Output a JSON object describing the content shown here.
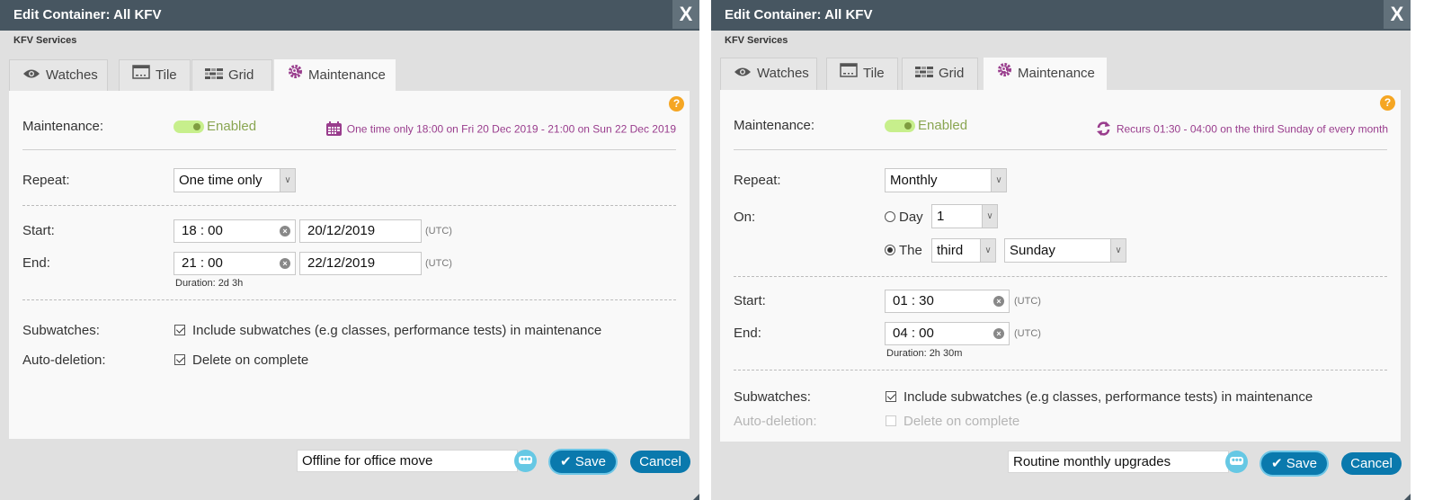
{
  "dialogs": [
    {
      "title": "Edit Container: All KFV",
      "close_label": "X",
      "subtitle": "KFV Services",
      "tabs": [
        {
          "label": "Watches",
          "icon": "eye-icon"
        },
        {
          "label": "Tile",
          "icon": "tile-icon"
        },
        {
          "label": "Grid",
          "icon": "grid-icon"
        },
        {
          "label": "Maintenance",
          "icon": "maintenance-gear-icon",
          "active": true
        }
      ],
      "help_label": "?",
      "maintenance": {
        "label": "Maintenance:",
        "toggle_state": "Enabled",
        "summary_icon": "calendar-icon",
        "summary": "One time only 18:00 on Fri 20 Dec 2019 - 21:00 on Sun 22 Dec 2019"
      },
      "repeat": {
        "label": "Repeat:",
        "value": "One time only"
      },
      "start": {
        "label": "Start:",
        "time": "18 : 00",
        "date": "20/12/2019",
        "tz": "(UTC)"
      },
      "end": {
        "label": "End:",
        "time": "21 : 00",
        "date": "22/12/2019",
        "tz": "(UTC)"
      },
      "duration": "Duration: 2d 3h",
      "subwatches": {
        "label": "Subwatches:",
        "text": "Include subwatches (e.g classes, performance tests) in maintenance",
        "checked": true
      },
      "autodeletion": {
        "label": "Auto-deletion:",
        "text": "Delete on complete",
        "checked": true,
        "disabled": false
      },
      "footer": {
        "note": "Offline for office move",
        "save_label": "Save",
        "cancel_label": "Cancel"
      }
    },
    {
      "title": "Edit Container: All KFV",
      "close_label": "X",
      "subtitle": "KFV Services",
      "tabs": [
        {
          "label": "Watches",
          "icon": "eye-icon"
        },
        {
          "label": "Tile",
          "icon": "tile-icon"
        },
        {
          "label": "Grid",
          "icon": "grid-icon"
        },
        {
          "label": "Maintenance",
          "icon": "maintenance-gear-icon",
          "active": true
        }
      ],
      "help_label": "?",
      "maintenance": {
        "label": "Maintenance:",
        "toggle_state": "Enabled",
        "summary_icon": "recur-icon",
        "summary": "Recurs 01:30 - 04:00 on the third Sunday of every month"
      },
      "repeat": {
        "label": "Repeat:",
        "value": "Monthly"
      },
      "on": {
        "label": "On:",
        "day_option": {
          "label": "Day",
          "value": "1",
          "selected": false
        },
        "the_option": {
          "label": "The",
          "ordinal": "third",
          "weekday": "Sunday",
          "selected": true
        }
      },
      "start": {
        "label": "Start:",
        "time": "01 : 30",
        "tz": "(UTC)"
      },
      "end": {
        "label": "End:",
        "time": "04 : 00",
        "tz": "(UTC)"
      },
      "duration": "Duration: 2h 30m",
      "subwatches": {
        "label": "Subwatches:",
        "text": "Include subwatches (e.g classes, performance tests) in maintenance",
        "checked": true
      },
      "autodeletion": {
        "label": "Auto-deletion:",
        "text": "Delete on complete",
        "checked": false,
        "disabled": true
      },
      "footer": {
        "note": "Routine monthly upgrades",
        "save_label": "Save",
        "cancel_label": "Cancel"
      }
    }
  ],
  "colors": {
    "titlebar": "#475661",
    "accent_purple": "#993d8d",
    "toggle_on": "#c7ef8c",
    "enabled_text": "#8aa652",
    "button_blue": "#0a79ad",
    "help_orange": "#f5a623"
  }
}
